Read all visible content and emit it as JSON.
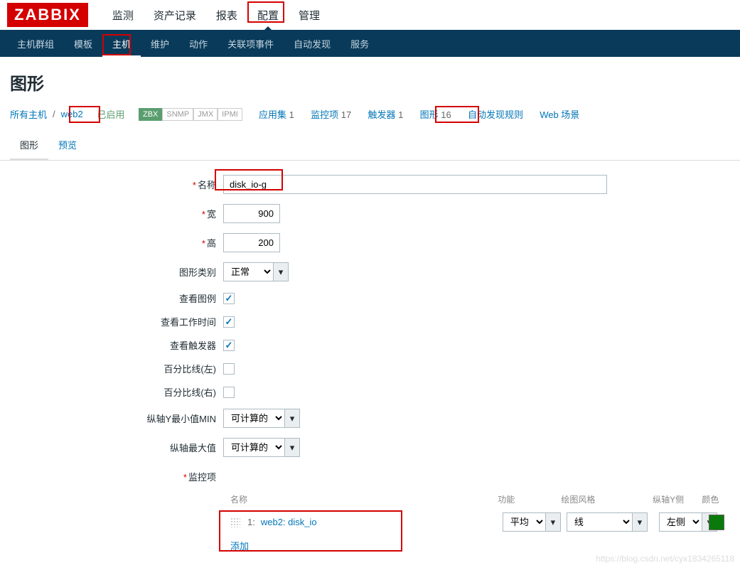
{
  "logo": "ZABBIX",
  "topnav": {
    "items": [
      "监测",
      "资产记录",
      "报表",
      "配置",
      "管理"
    ],
    "active_index": 3
  },
  "subnav": {
    "items": [
      "主机群组",
      "模板",
      "主机",
      "维护",
      "动作",
      "关联项事件",
      "自动发现",
      "服务"
    ],
    "active_index": 2
  },
  "page_title": "图形",
  "breadcrumb": {
    "all_hosts": "所有主机",
    "host": "web2",
    "status": "已启用",
    "badges": [
      "ZBX",
      "SNMP",
      "JMX",
      "IPMI"
    ],
    "links": [
      {
        "label": "应用集",
        "count": 1
      },
      {
        "label": "监控项",
        "count": 17
      },
      {
        "label": "触发器",
        "count": 1
      },
      {
        "label": "图形",
        "count": 16
      },
      {
        "label": "自动发现规则",
        "count": null
      },
      {
        "label": "Web 场景",
        "count": null
      }
    ]
  },
  "tabs": {
    "items": [
      "图形",
      "预览"
    ],
    "active_index": 0
  },
  "form": {
    "name_label": "名称",
    "name_value": "disk_io-g",
    "width_label": "宽",
    "width_value": "900",
    "height_label": "高",
    "height_value": "200",
    "type_label": "图形类别",
    "type_value": "正常",
    "legend_label": "查看图例",
    "legend_checked": true,
    "worktime_label": "查看工作时间",
    "worktime_checked": true,
    "triggers_label": "查看触发器",
    "triggers_checked": true,
    "percent_left_label": "百分比线(左)",
    "percent_left_checked": false,
    "percent_right_label": "百分比线(右)",
    "percent_right_checked": false,
    "ymin_label": "纵轴Y最小值MIN",
    "ymin_value": "可计算的",
    "ymax_label": "纵轴最大值",
    "ymax_value": "可计算的",
    "items_label": "监控项",
    "items_headers": {
      "name": "名称",
      "func": "功能",
      "style": "绘图风格",
      "side": "纵轴Y侧",
      "color": "颜色"
    },
    "items": [
      {
        "idx": "1:",
        "name": "web2: disk_io",
        "func": "平均",
        "style": "线",
        "side": "左侧",
        "color": "#0a7a0a"
      }
    ],
    "add_label": "添加"
  },
  "watermark": "https://blog.csdn.net/cyx1834265118"
}
